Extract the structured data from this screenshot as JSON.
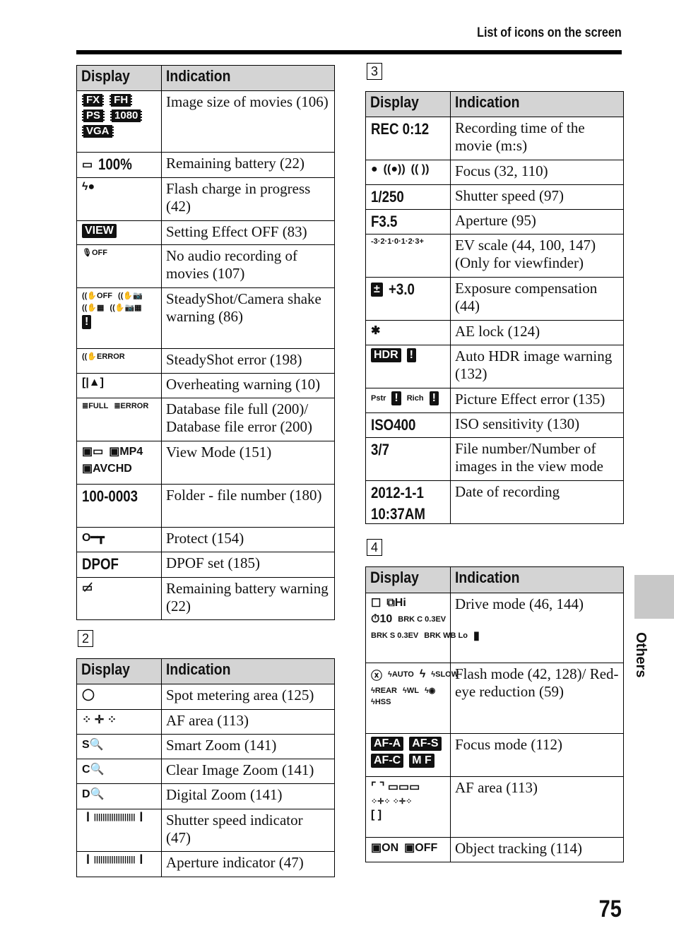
{
  "header": {
    "title": "List of icons on the screen"
  },
  "side_tab": {
    "label": "Others"
  },
  "page_number": "75",
  "columns": {
    "display": "Display",
    "indication": "Indication"
  },
  "tables": [
    {
      "section": "",
      "rows": [
        {
          "display": [
            [
              {
                "text": "FX",
                "style": "box"
              },
              {
                "text": "FH",
                "style": "box"
              }
            ],
            [
              {
                "text": "PS",
                "style": "box"
              },
              {
                "text": "1080",
                "style": "box"
              }
            ],
            [
              {
                "text": "VGA",
                "style": "box"
              }
            ]
          ],
          "indication": "Image size of movies (106)"
        },
        {
          "display": [
            [
              {
                "text": "▭",
                "style": "sym"
              },
              {
                "text": "100%",
                "style": "big"
              }
            ]
          ],
          "indication": "Remaining battery (22)"
        },
        {
          "display": [
            [
              {
                "text": "ϟ●",
                "style": "sym"
              }
            ]
          ],
          "indication": "Flash charge in progress (42)"
        },
        {
          "display": [
            [
              {
                "text": "VIEW",
                "style": "inv"
              }
            ]
          ],
          "indication": "Setting Effect OFF (83)"
        },
        {
          "display": [
            [
              {
                "text": "🎙OFF",
                "style": "sm"
              }
            ]
          ],
          "indication": "No audio recording of movies (107)"
        },
        {
          "display": [
            [
              {
                "text": "((✋OFF",
                "style": "sm"
              },
              {
                "text": "((✋📷",
                "style": "sm"
              }
            ],
            [
              {
                "text": "((✋▦",
                "style": "sm"
              },
              {
                "text": "((✋📷▦",
                "style": "sm"
              }
            ],
            [
              {
                "text": "!",
                "style": "inv"
              }
            ]
          ],
          "indication": "SteadyShot/Camera shake warning (86)"
        },
        {
          "display": [
            [
              {
                "text": "((✋ERROR",
                "style": "sm"
              }
            ]
          ],
          "indication": "SteadyShot error (198)"
        },
        {
          "display": [
            [
              {
                "text": "[|▲]",
                "style": "sym"
              }
            ]
          ],
          "indication": "Overheating warning (10)"
        },
        {
          "display": [
            [
              {
                "text": "≣FULL",
                "style": "sm"
              },
              {
                "text": "≣ERROR",
                "style": "sm"
              }
            ]
          ],
          "indication": "Database file full (200)/ Database file error (200)"
        },
        {
          "display": [
            [
              {
                "text": "▣▭",
                "style": "sym"
              },
              {
                "text": "▣MP4",
                "style": "sym"
              }
            ],
            [
              {
                "text": "▣AVCHD",
                "style": "sym"
              }
            ]
          ],
          "indication": "View Mode (151)"
        },
        {
          "display": [
            [
              {
                "text": "100-0003",
                "style": "big"
              }
            ]
          ],
          "indication": "Folder - file number (180)"
        },
        {
          "display": [
            [
              {
                "text": "O━┳",
                "style": "sym"
              }
            ]
          ],
          "indication": "Protect (154)"
        },
        {
          "display": [
            [
              {
                "text": "DPOF",
                "style": "big"
              }
            ]
          ],
          "indication": "DPOF set (185)"
        },
        {
          "display": [
            [
              {
                "text": "▭̸",
                "style": "sym"
              }
            ]
          ],
          "indication": "Remaining battery warning (22)"
        }
      ]
    },
    {
      "section": "2",
      "rows": [
        {
          "display": [
            [
              {
                "text": "◯",
                "style": "sym"
              }
            ]
          ],
          "indication": "Spot metering area (125)"
        },
        {
          "display": [
            [
              {
                "text": "⁘ ✛ ⁘",
                "style": "sym"
              }
            ]
          ],
          "indication": "AF area (113)"
        },
        {
          "display": [
            [
              {
                "text": "S🔍",
                "style": "sym"
              }
            ]
          ],
          "indication": "Smart Zoom (141)"
        },
        {
          "display": [
            [
              {
                "text": "C🔍",
                "style": "sym"
              }
            ]
          ],
          "indication": "Clear Image Zoom (141)"
        },
        {
          "display": [
            [
              {
                "text": "D🔍",
                "style": "sym"
              }
            ]
          ],
          "indication": "Digital Zoom (141)"
        },
        {
          "display": [
            [
              {
                "text": "▕▏|||||||||||||||||||▕▏",
                "style": "sm"
              }
            ]
          ],
          "indication": "Shutter speed indicator (47)"
        },
        {
          "display": [
            [
              {
                "text": "▕▏|||||||||||||||||||▕▏",
                "style": "sm"
              }
            ]
          ],
          "indication": "Aperture indicator (47)"
        }
      ]
    },
    {
      "section": "3",
      "rows": [
        {
          "display": [
            [
              {
                "text": "REC 0:12",
                "style": "big"
              }
            ]
          ],
          "indication": "Recording time of the movie (m:s)"
        },
        {
          "display": [
            [
              {
                "text": "●",
                "style": "sym"
              },
              {
                "text": "((●))",
                "style": "sym"
              },
              {
                "text": "(( ))",
                "style": "sym"
              }
            ]
          ],
          "indication": "Focus (32, 110)"
        },
        {
          "display": [
            [
              {
                "text": "1/250",
                "style": "big"
              }
            ]
          ],
          "indication": "Shutter speed (97)"
        },
        {
          "display": [
            [
              {
                "text": "F3.5",
                "style": "big"
              }
            ]
          ],
          "indication": "Aperture (95)"
        },
        {
          "display": [
            [
              {
                "text": "-3·2·1·0·1·2·3+",
                "style": "sm"
              }
            ]
          ],
          "indication": "EV scale (44, 100, 147) (Only for viewfinder)"
        },
        {
          "display": [
            [
              {
                "text": "±",
                "style": "inv"
              },
              {
                "text": "+3.0",
                "style": "big"
              }
            ]
          ],
          "indication": "Exposure compensation (44)"
        },
        {
          "display": [
            [
              {
                "text": "✱",
                "style": "sym"
              }
            ]
          ],
          "indication": "AE lock (124)"
        },
        {
          "display": [
            [
              {
                "text": "HDR",
                "style": "inv"
              },
              {
                "text": "!",
                "style": "inv"
              }
            ]
          ],
          "indication": "Auto HDR image warning (132)"
        },
        {
          "display": [
            [
              {
                "text": "Pstr",
                "style": "sm"
              },
              {
                "text": "!",
                "style": "inv"
              },
              {
                "text": "Rich",
                "style": "sm"
              },
              {
                "text": "!",
                "style": "inv"
              }
            ]
          ],
          "indication": "Picture Effect error (135)"
        },
        {
          "display": [
            [
              {
                "text": "ISO400",
                "style": "big"
              }
            ]
          ],
          "indication": "ISO sensitivity (130)"
        },
        {
          "display": [
            [
              {
                "text": "3/7",
                "style": "big"
              }
            ]
          ],
          "indication": "File number/Number of images in the view mode"
        },
        {
          "display": [
            [
              {
                "text": "2012-1-1",
                "style": "big"
              }
            ],
            [
              {
                "text": "10:37AM",
                "style": "big"
              }
            ]
          ],
          "indication": "Date of recording"
        }
      ]
    },
    {
      "section": "4",
      "rows": [
        {
          "display": [
            [
              {
                "text": "☐",
                "style": "sym"
              },
              {
                "text": "⧉Hi",
                "style": "sym"
              }
            ],
            [
              {
                "text": "⏱10",
                "style": "sym"
              },
              {
                "text": "BRK C 0.3EV",
                "style": "sm"
              }
            ],
            [
              {
                "text": "BRK S 0.3EV",
                "style": "sm"
              },
              {
                "text": "BRK WB Lo",
                "style": "sm"
              },
              {
                "text": "▮",
                "style": "sym"
              }
            ]
          ],
          "indication": "Drive mode (46, 144)"
        },
        {
          "display": [
            [
              {
                "text": "ⓧ",
                "style": "sym"
              },
              {
                "text": "ϟAUTO",
                "style": "sm"
              },
              {
                "text": "ϟ",
                "style": "sym"
              },
              {
                "text": "ϟSLOW",
                "style": "sm"
              }
            ],
            [
              {
                "text": "ϟREAR",
                "style": "sm"
              },
              {
                "text": "ϟWL",
                "style": "sm"
              },
              {
                "text": "ϟ◉",
                "style": "sm"
              }
            ],
            [
              {
                "text": "ϟHSS",
                "style": "sm"
              }
            ]
          ],
          "indication": "Flash mode (42, 128)/ Red-eye reduction (59)"
        },
        {
          "display": [
            [
              {
                "text": "AF-A",
                "style": "inv"
              },
              {
                "text": "AF-S",
                "style": "inv"
              }
            ],
            [
              {
                "text": "AF-C",
                "style": "inv"
              },
              {
                "text": "M F",
                "style": "inv"
              }
            ]
          ],
          "indication": "Focus mode (112)"
        },
        {
          "display": [
            [
              {
                "text": "⌜  ⌝ ▭▭▭",
                "style": "sym"
              }
            ],
            [
              {
                "text": "⁘✛⁘ ⁘✛⁘",
                "style": "sm"
              }
            ],
            [
              {
                "text": "[ ]",
                "style": "sym"
              }
            ]
          ],
          "indication": "AF area (113)"
        },
        {
          "display": [
            [
              {
                "text": "▣ON",
                "style": "sym"
              },
              {
                "text": "▣OFF",
                "style": "sym"
              }
            ]
          ],
          "indication": "Object tracking (114)"
        }
      ]
    }
  ]
}
